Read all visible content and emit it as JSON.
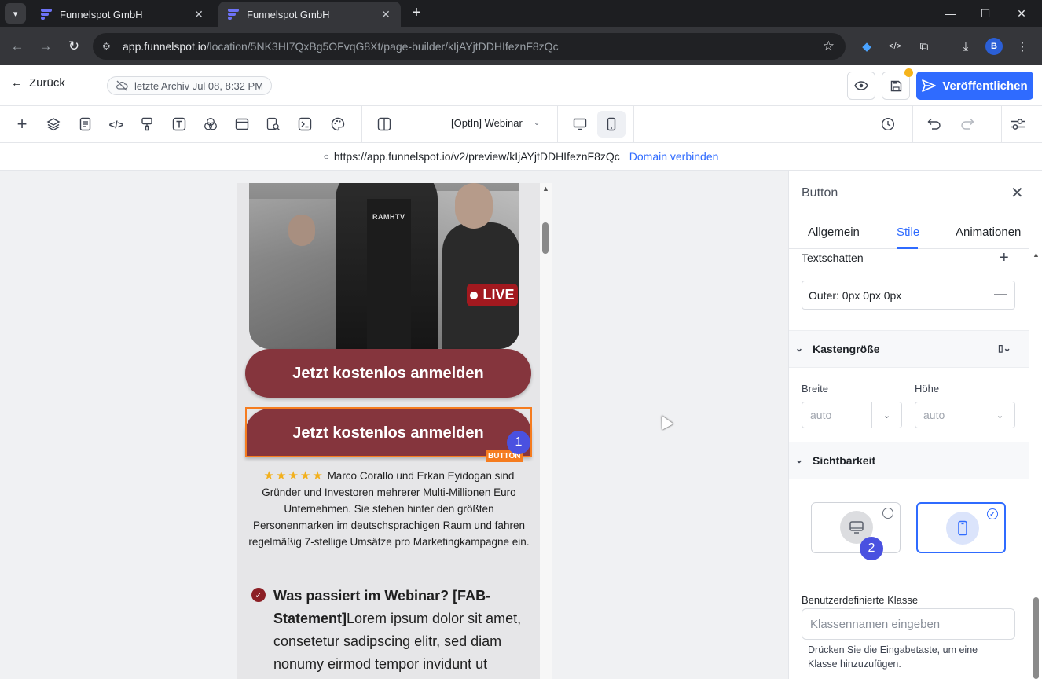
{
  "browser": {
    "tabs": [
      {
        "title": "Funnelspot GmbH",
        "active": false
      },
      {
        "title": "Funnelspot GmbH",
        "active": true
      }
    ],
    "url_host": "app.funnelspot.io",
    "url_path": "/location/5NK3HI7QxBg5OFvqG8Xt/page-builder/kIjAYjtDDHIfeznF8zQc",
    "profile_initial": "B"
  },
  "header": {
    "back_label": "Zurück",
    "archive_label": "letzte Archiv Jul 08, 8:32 PM",
    "publish_label": "Veröffentlichen"
  },
  "toolbar": {
    "page_select": "[OptIn] Webinar",
    "active_device": "mobile"
  },
  "preview": {
    "url": "https://app.funnelspot.io/v2/preview/kIjAYjtDDHIfeznF8zQc",
    "connect_domain": "Domain verbinden"
  },
  "canvas": {
    "live_badge": "LIVE",
    "hero_shirt_text": "RAMHTV",
    "cta_1": "Jetzt kostenlos anmelden",
    "cta_2": "Jetzt kostenlos anmelden",
    "selected_tag": "BUTTON",
    "marker_1": "1",
    "stars": "★★★★★",
    "bio": "Marco Corallo und Erkan Eyidogan sind Gründer und Investoren mehrerer Multi-Millionen Euro Unternehmen. Sie stehen hinter den größten Personenmarken im deutschsprachigen Raum und fahren regelmäßig 7-stellige Umsätze pro Marketingkampagne ein.",
    "bullet_bold": "Was passiert im Webinar? [FAB-Statement]",
    "bullet_text": "Lorem ipsum dolor sit amet, consetetur sadipscing elitr, sed diam nonumy eirmod tempor invidunt ut"
  },
  "panel": {
    "title": "Button",
    "tabs": [
      "Allgemein",
      "Stile",
      "Animationen"
    ],
    "active_tab": "Stile",
    "text_shadow_label": "Textschatten",
    "text_shadow_value": "Outer: 0px 0px 0px",
    "box_size_label": "Kastengröße",
    "width_label": "Breite",
    "width_value": "auto",
    "height_label": "Höhe",
    "height_value": "auto",
    "visibility_label": "Sichtbarkeit",
    "visibility": {
      "desktop": false,
      "mobile": true
    },
    "marker_2": "2",
    "custom_class_label": "Benutzerdefinierte Klasse",
    "custom_class_placeholder": "Klassennamen eingeben",
    "custom_class_help": "Drücken Sie die Eingabetaste, um eine Klasse hinzuzufügen."
  },
  "colors": {
    "accent": "#2f6bff",
    "cta": "#85353d",
    "selection": "#f57c1f",
    "marker": "#4a51e0"
  }
}
